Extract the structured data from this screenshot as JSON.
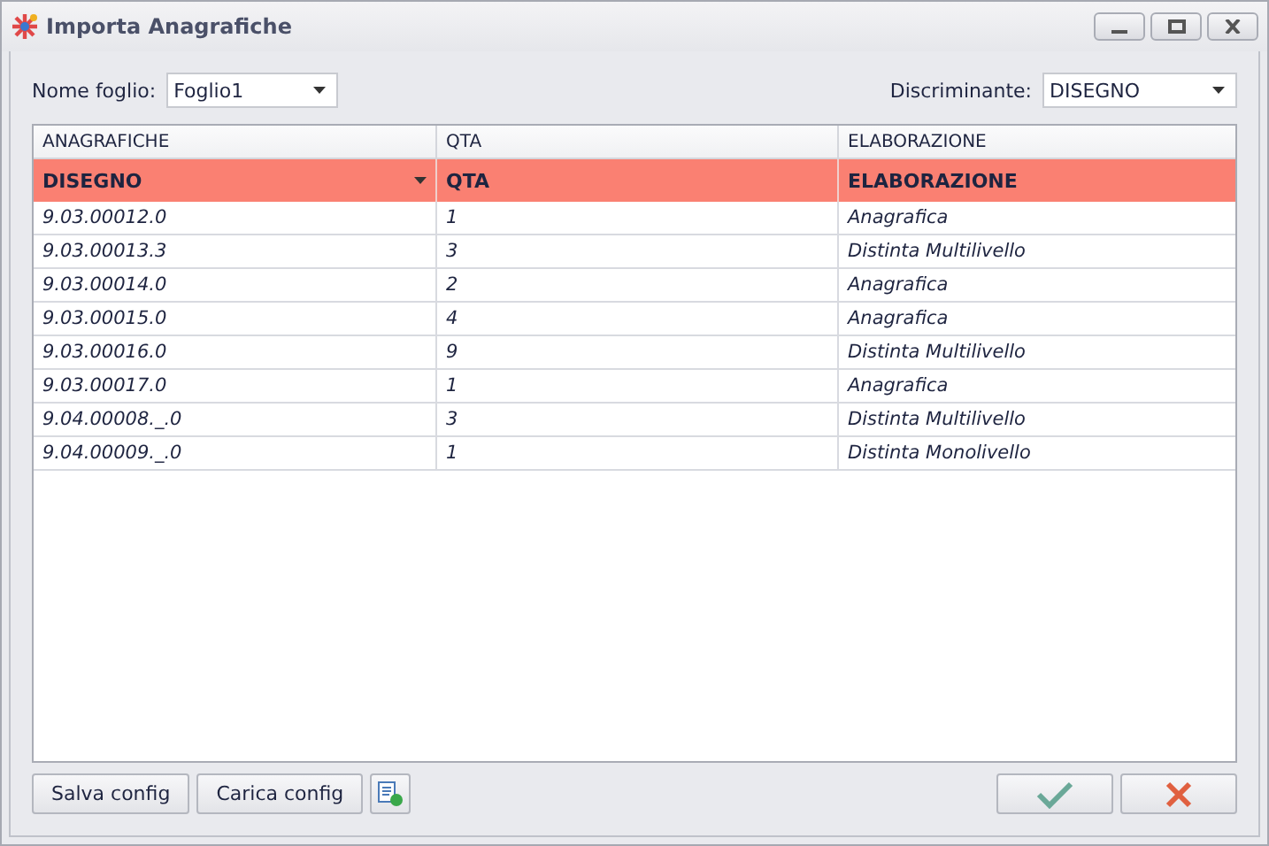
{
  "window": {
    "title": "Importa Anagrafiche"
  },
  "sheet": {
    "label": "Nome foglio:",
    "value": "Foglio1"
  },
  "discriminant": {
    "label": "Discriminante:",
    "value": "DISEGNO"
  },
  "table": {
    "columns": [
      "ANAGRAFICHE",
      "QTA",
      "ELABORAZIONE"
    ],
    "mapping": [
      {
        "text": "DISEGNO",
        "dropdown": true
      },
      {
        "text": "QTA",
        "dropdown": false
      },
      {
        "text": "ELABORAZIONE",
        "dropdown": false
      }
    ],
    "rows": [
      [
        "9.03.00012.0",
        "1",
        "Anagrafica"
      ],
      [
        "9.03.00013.3",
        "3",
        "Distinta Multilivello"
      ],
      [
        "9.03.00014.0",
        "2",
        "Anagrafica"
      ],
      [
        "9.03.00015.0",
        "4",
        "Anagrafica"
      ],
      [
        "9.03.00016.0",
        "9",
        "Distinta Multilivello"
      ],
      [
        "9.03.00017.0",
        "1",
        "Anagrafica"
      ],
      [
        "9.04.00008._.0",
        "3",
        "Distinta Multilivello"
      ],
      [
        "9.04.00009._.0",
        "1",
        "Distinta Monolivello"
      ]
    ]
  },
  "buttons": [
    "Salva config",
    "Carica config"
  ]
}
